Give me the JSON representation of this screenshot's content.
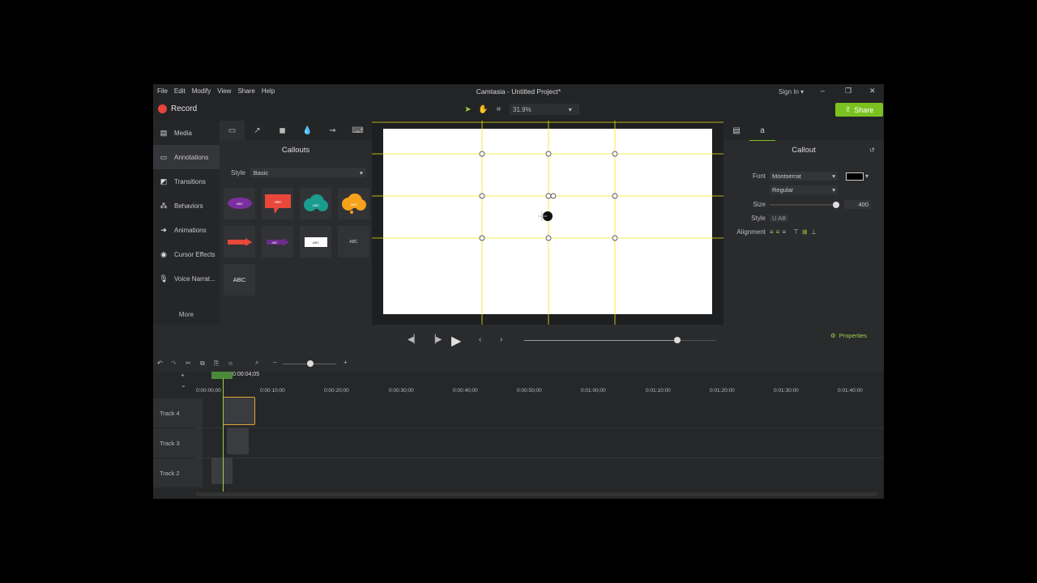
{
  "window": {
    "title": "Camtasia - Untitled Project*",
    "menu": [
      "File",
      "Edit",
      "Modify",
      "View",
      "Share",
      "Help"
    ],
    "signin": "Sign In",
    "controls": [
      "–",
      "❐",
      "✕"
    ]
  },
  "toolbar": {
    "record_label": "Record",
    "zoom": "31.9%",
    "share_label": "Share"
  },
  "sidebar": {
    "items": [
      {
        "label": "Media",
        "icon": "film-icon"
      },
      {
        "label": "Annotations",
        "icon": "annotation-icon"
      },
      {
        "label": "Transitions",
        "icon": "transition-icon"
      },
      {
        "label": "Behaviors",
        "icon": "behavior-icon"
      },
      {
        "label": "Animations",
        "icon": "animation-icon"
      },
      {
        "label": "Cursor Effects",
        "icon": "cursor-icon"
      },
      {
        "label": "Voice Narrat...",
        "icon": "mic-icon"
      }
    ],
    "more_label": "More"
  },
  "library": {
    "title": "Callouts",
    "style_label": "Style",
    "style_value": "Basic",
    "callouts": [
      "ABC",
      "ABC",
      "ABC",
      "ABC",
      "",
      "ABC",
      "ABC",
      "ABC",
      "ABC"
    ]
  },
  "properties": {
    "title": "Callout",
    "font_label": "Font",
    "font_value": "Montserrat",
    "weight_value": "Regular",
    "size_label": "Size",
    "size_value": "400",
    "size_fraction": 0.95,
    "style_label": "Style",
    "style_text": "U AB",
    "alignment_label": "Alignment",
    "properties_button": "Properties"
  },
  "timeline": {
    "playhead_time": "0:00:04;05",
    "ticks": [
      "0:00:00;00",
      "0:00:10;00",
      "0:00:20;00",
      "0:00:30;00",
      "0:00:40;00",
      "0:00:50;00",
      "0:01:00;00",
      "0:01:10;00",
      "0:01:20;00",
      "0:01:30;00",
      "0:01:40;00"
    ],
    "tracks": [
      "Track 4",
      "Track 3",
      "Track 2"
    ],
    "playback_position": 0.8
  },
  "colors": {
    "accent": "#7bc221",
    "record": "#e5463c",
    "guide": "#f2e61a"
  }
}
